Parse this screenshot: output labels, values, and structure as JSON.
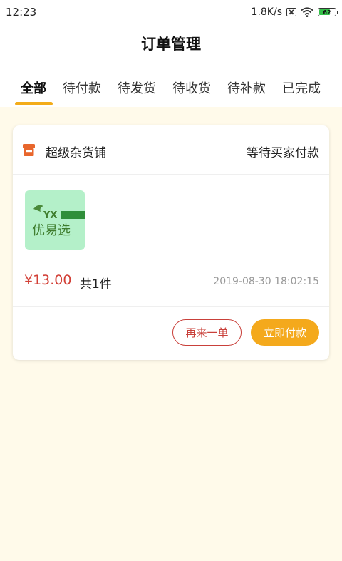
{
  "status_bar": {
    "time": "12:23",
    "speed": "1.8K/s",
    "battery": "62"
  },
  "header": {
    "title": "订单管理"
  },
  "tabs": [
    {
      "label": "全部",
      "active": true
    },
    {
      "label": "待付款",
      "active": false
    },
    {
      "label": "待发货",
      "active": false
    },
    {
      "label": "待收货",
      "active": false
    },
    {
      "label": "待补款",
      "active": false
    },
    {
      "label": "已完成",
      "active": false
    }
  ],
  "order": {
    "shop_name": "超级杂货铺",
    "status": "等待买家付款",
    "product": {
      "logo_text": "优易选",
      "logo_mark": "YX",
      "thumb_color": "#b4f0c9"
    },
    "price": "¥13.00",
    "count": "共1件",
    "time": "2019-08-30 18:02:15",
    "buttons": {
      "reorder": "再来一单",
      "pay": "立即付款"
    }
  },
  "colors": {
    "accent": "#f4a91c",
    "price_red": "#d23f36",
    "background": "#fffaea"
  }
}
